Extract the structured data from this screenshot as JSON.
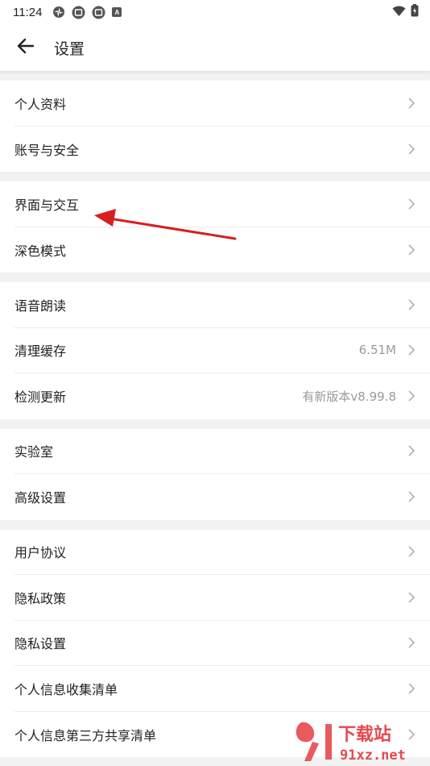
{
  "status": {
    "time": "11:24",
    "icon_a": "A"
  },
  "header": {
    "title": "设置",
    "back_icon": "arrow-left-icon"
  },
  "groups": [
    {
      "items": [
        {
          "label": "个人资料"
        },
        {
          "label": "账号与安全"
        }
      ]
    },
    {
      "items": [
        {
          "label": "界面与交互"
        },
        {
          "label": "深色模式"
        }
      ]
    },
    {
      "items": [
        {
          "label": "语音朗读"
        },
        {
          "label": "清理缓存",
          "value": "6.51M"
        },
        {
          "label": "检测更新",
          "value": "有新版本v8.99.8"
        }
      ]
    },
    {
      "items": [
        {
          "label": "实验室"
        },
        {
          "label": "高级设置"
        }
      ]
    },
    {
      "items": [
        {
          "label": "用户协议"
        },
        {
          "label": "隐私政策"
        },
        {
          "label": "隐私设置"
        },
        {
          "label": "个人信息收集清单"
        },
        {
          "label": "个人信息第三方共享清单"
        }
      ]
    }
  ],
  "watermark": {
    "top": "下载站",
    "bottom": "91xz.net"
  },
  "colors": {
    "annotation": "#d62020",
    "chevron": "#b0b0b0"
  }
}
